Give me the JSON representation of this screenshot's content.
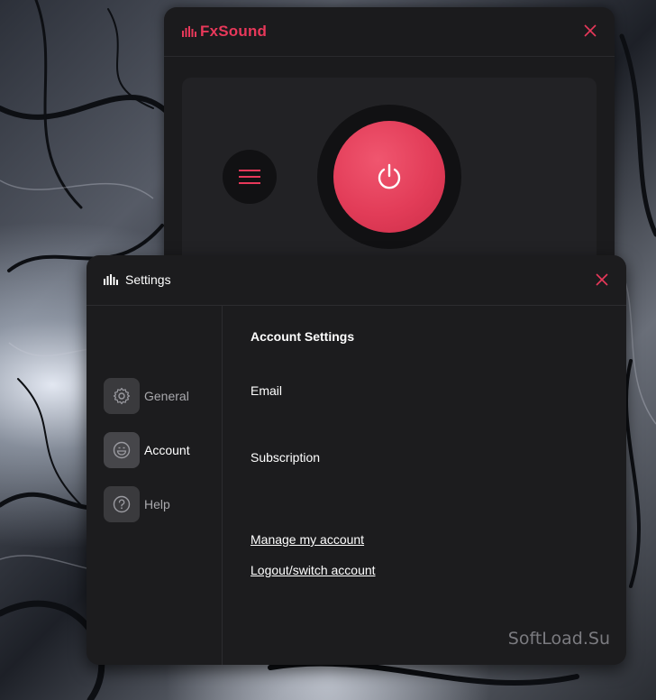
{
  "main_window": {
    "app_name": "FxSound",
    "accent_color": "#e8385a"
  },
  "settings": {
    "title": "Settings",
    "nav": [
      {
        "label": "General",
        "icon": "gear-icon"
      },
      {
        "label": "Account",
        "icon": "smiley-icon",
        "active": true
      },
      {
        "label": "Help",
        "icon": "question-icon"
      }
    ],
    "content": {
      "heading": "Account Settings",
      "email_label": "Email",
      "subscription_label": "Subscription",
      "manage_link": "Manage my account",
      "logout_link": "Logout/switch account"
    },
    "watermark": "SoftLoad.Su"
  }
}
